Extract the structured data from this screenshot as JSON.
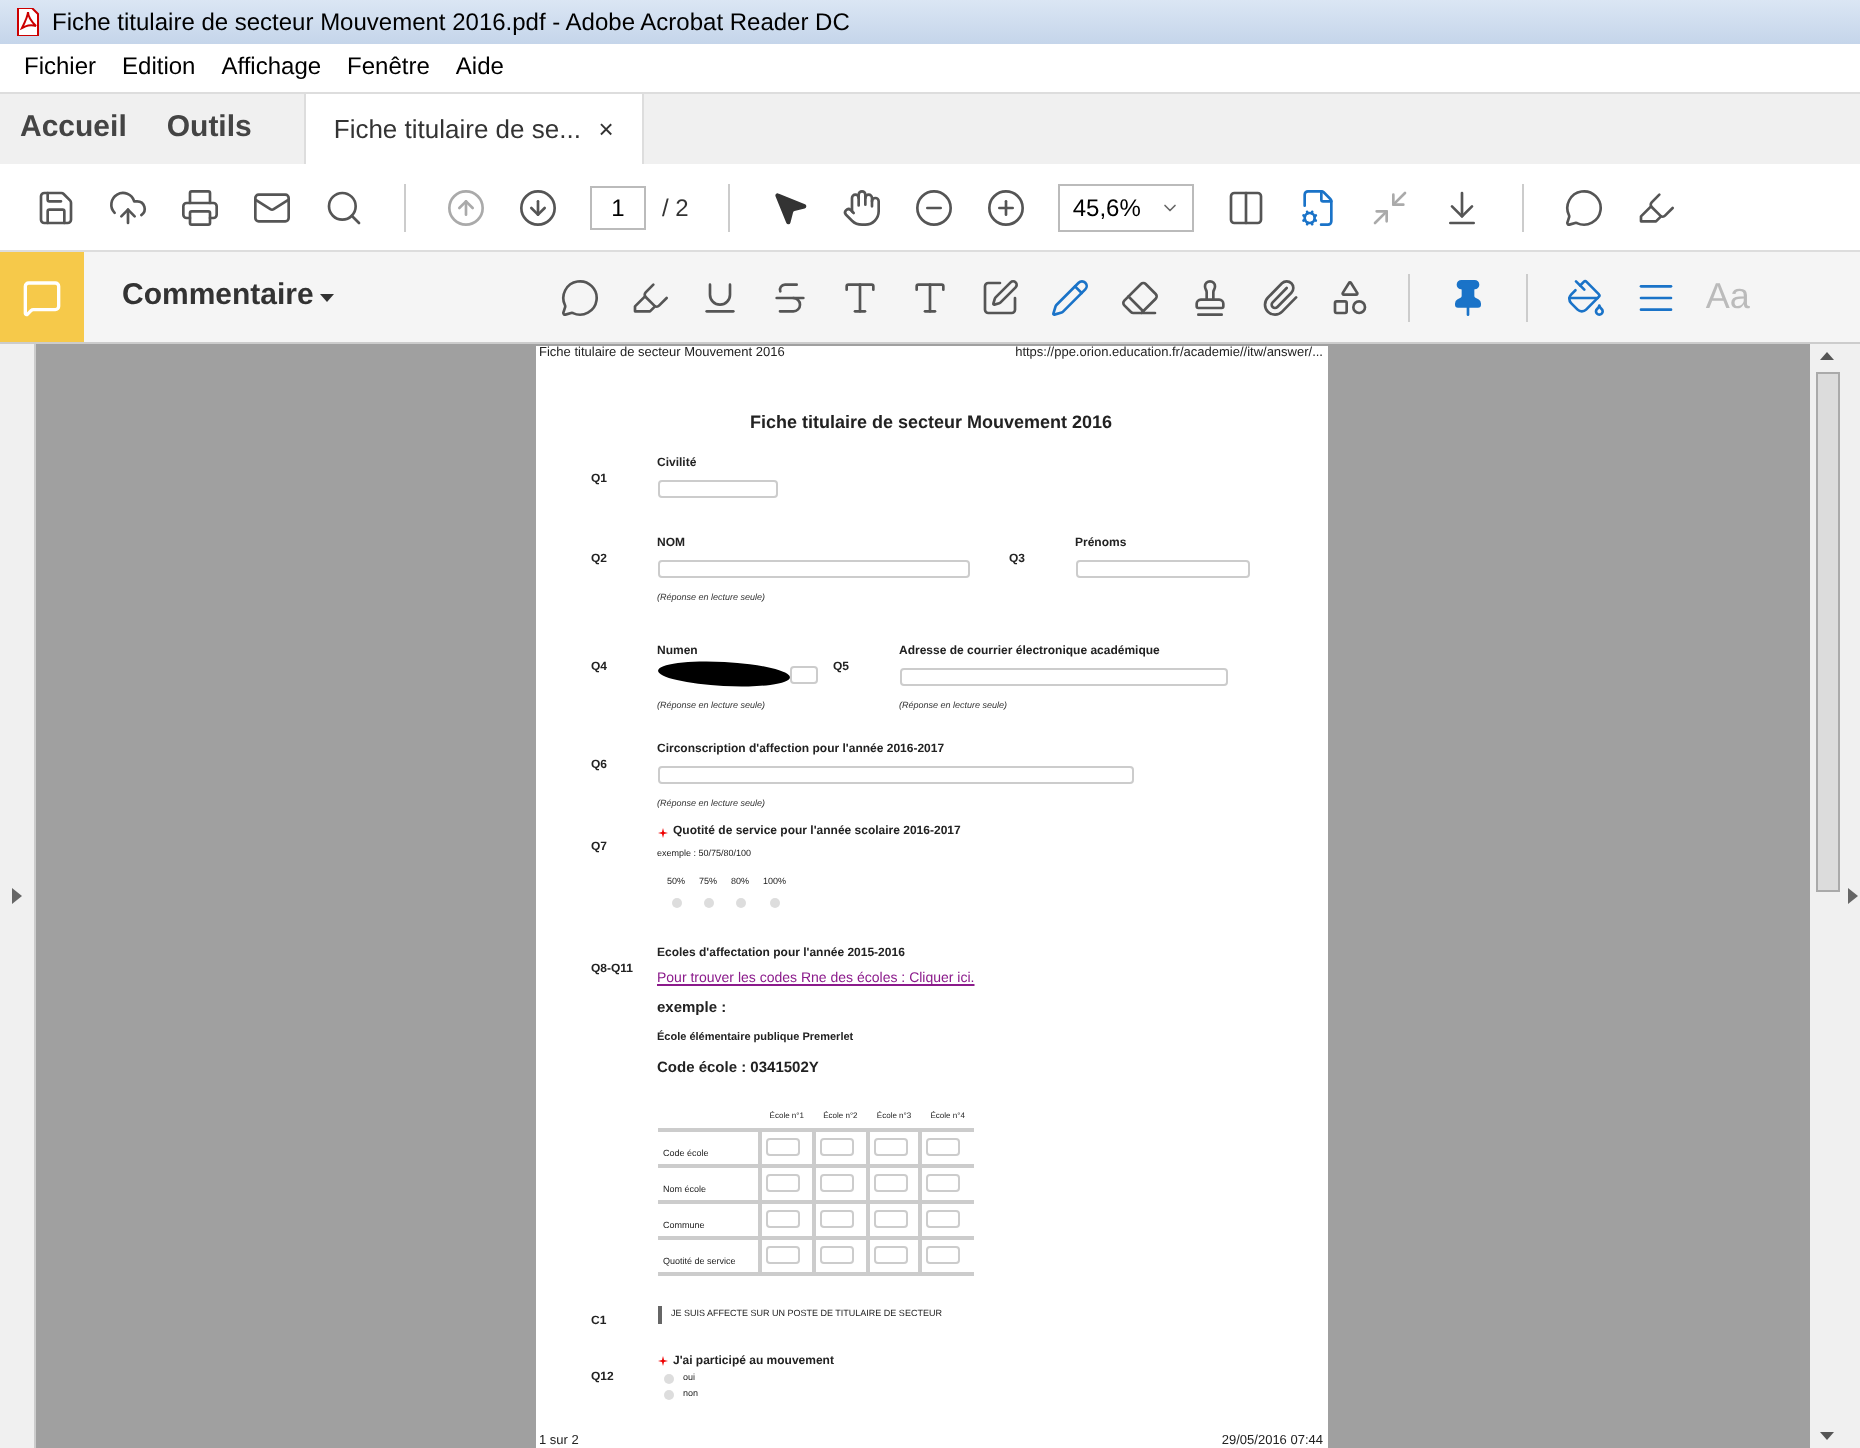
{
  "window": {
    "title": "Fiche titulaire de secteur Mouvement 2016.pdf - Adobe Acrobat Reader DC"
  },
  "menu": [
    "Fichier",
    "Edition",
    "Affichage",
    "Fenêtre",
    "Aide"
  ],
  "tabs": [
    {
      "label": "Accueil",
      "kind": "nav",
      "selected": false
    },
    {
      "label": "Outils",
      "kind": "nav",
      "selected": false
    },
    {
      "label": "Fiche titulaire de se...",
      "kind": "document",
      "selected": true,
      "close": "×"
    }
  ],
  "toolbar": {
    "page": "1",
    "page_total": "/ 2",
    "zoom": "45,6%"
  },
  "comment_bar": {
    "label": "Commentaire",
    "font_button": "Aa"
  },
  "document": {
    "header_left": "Fiche titulaire de secteur Mouvement 2016",
    "header_right": "https://ppe.orion.education.fr/academie//itw/answer/...",
    "title": "Fiche titulaire de secteur Mouvement 2016",
    "q1": {
      "number": "Q1",
      "label": "Civilité"
    },
    "q2": {
      "number": "Q2",
      "label": "NOM",
      "note": "(Réponse en lecture seule)"
    },
    "q3": {
      "number": "Q3",
      "label": "Prénoms"
    },
    "q4": {
      "number": "Q4",
      "label": "Numen",
      "note": "(Réponse en lecture seule)"
    },
    "q5": {
      "number": "Q5",
      "label": "Adresse de courrier électronique académique",
      "note": "(Réponse en lecture seule)"
    },
    "q6": {
      "number": "Q6",
      "label": "Circonscription d'affection pour l'année 2016-2017",
      "note": "(Réponse en lecture seule)"
    },
    "q7": {
      "number": "Q7",
      "label": "Quotité de service pour l'année scolaire 2016-2017",
      "required": true,
      "hint": "exemple : 50/75/80/100",
      "options": [
        {
          "label": "50%",
          "selected": false
        },
        {
          "label": "75%",
          "selected": false
        },
        {
          "label": "80%",
          "selected": false
        },
        {
          "label": "100%",
          "selected": false
        }
      ]
    },
    "q8": {
      "number": "Q8-Q11",
      "label": "Ecoles d'affectation pour l'année 2015-2016",
      "link": "Pour trouver les codes Rne des écoles : Cliquer ici.",
      "example_heading": "exemple :",
      "example_school": "École élémentaire publique Premerlet",
      "example_code": "Code école : 0341502Y",
      "table": {
        "columns": [
          "École n°1",
          "École n°2",
          "École n°3",
          "École n°4"
        ],
        "rows": [
          "Code école",
          "Nom école",
          "Commune",
          "Quotité de service"
        ]
      }
    },
    "c1": {
      "number": "C1",
      "label": "JE SUIS AFFECTE SUR UN POSTE DE TITULAIRE DE SECTEUR"
    },
    "q12": {
      "number": "Q12",
      "label": "J'ai participé au mouvement",
      "required": true,
      "options": [
        {
          "label": "oui",
          "selected": false
        },
        {
          "label": "non",
          "selected": false
        }
      ]
    },
    "footer_left": "1 sur 2",
    "footer_right": "29/05/2016 07:44"
  }
}
